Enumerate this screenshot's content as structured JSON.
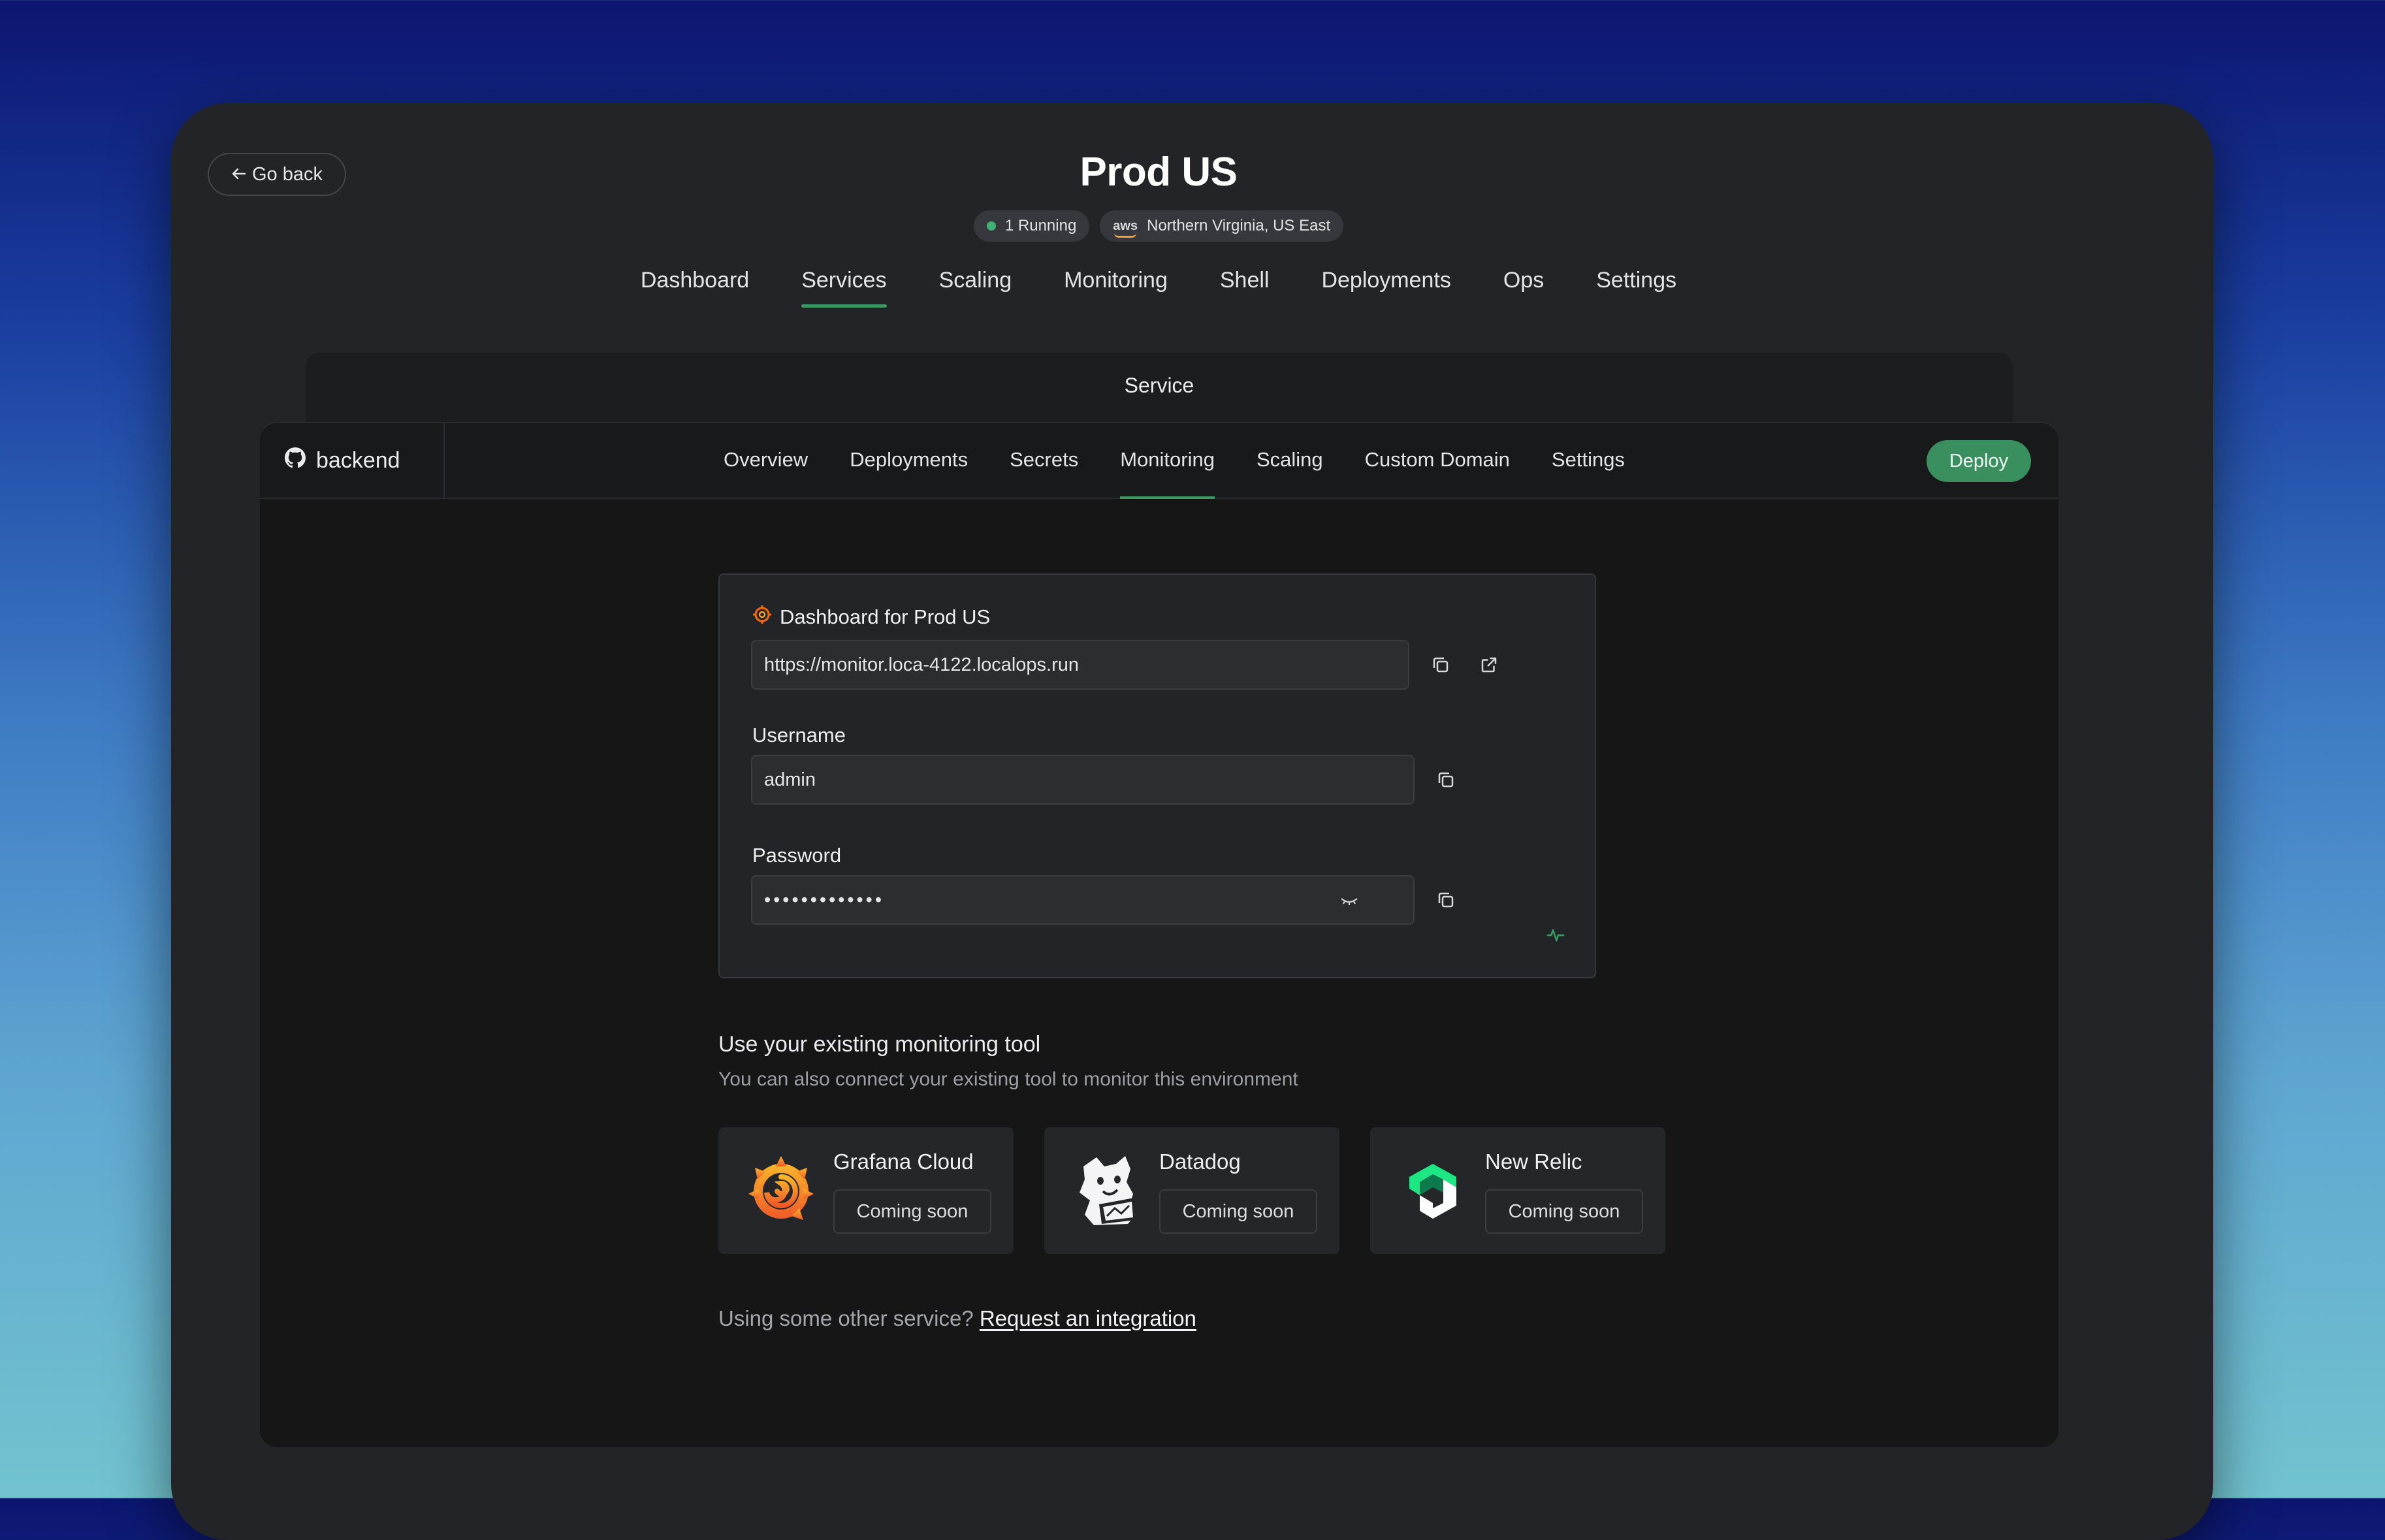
{
  "nav": {
    "back_label": "Go back"
  },
  "header": {
    "title": "Prod US",
    "status_badge": "1 Running",
    "region_badge": {
      "provider": "aws",
      "label": "Northern Virginia, US East"
    }
  },
  "top_tabs": [
    {
      "label": "Dashboard",
      "active": false
    },
    {
      "label": "Services",
      "active": true
    },
    {
      "label": "Scaling",
      "active": false
    },
    {
      "label": "Monitoring",
      "active": false
    },
    {
      "label": "Shell",
      "active": false
    },
    {
      "label": "Deployments",
      "active": false
    },
    {
      "label": "Ops",
      "active": false
    },
    {
      "label": "Settings",
      "active": false
    }
  ],
  "service_header": "Service",
  "service": {
    "repo_name": "backend",
    "tabs": [
      {
        "label": "Overview",
        "active": false
      },
      {
        "label": "Deployments",
        "active": false
      },
      {
        "label": "Secrets",
        "active": false
      },
      {
        "label": "Monitoring",
        "active": true
      },
      {
        "label": "Scaling",
        "active": false
      },
      {
        "label": "Custom Domain",
        "active": false
      },
      {
        "label": "Settings",
        "active": false
      }
    ],
    "deploy_label": "Deploy"
  },
  "dashboard": {
    "title": "Dashboard for Prod US",
    "url": "https://monitor.loca-4122.localops.run",
    "username_label": "Username",
    "username": "admin",
    "password_label": "Password",
    "password_mask": "•••••••••••••"
  },
  "monitoring": {
    "heading": "Use your existing monitoring tool",
    "subheading": "You can also connect your existing tool to monitor this environment",
    "tools": [
      {
        "name": "Grafana Cloud",
        "status": "Coming soon",
        "icon": "grafana-logo-icon"
      },
      {
        "name": "Datadog",
        "status": "Coming soon",
        "icon": "datadog-logo-icon"
      },
      {
        "name": "New Relic",
        "status": "Coming soon",
        "icon": "newrelic-logo-icon"
      }
    ],
    "footer_question": "Using some other service?",
    "footer_link": "Request an integration"
  },
  "colors": {
    "accent": "#3a9a62",
    "deploy": "#3a8f5f",
    "grafana_orange": "#f46800",
    "newrelic_green": "#1ce783"
  }
}
